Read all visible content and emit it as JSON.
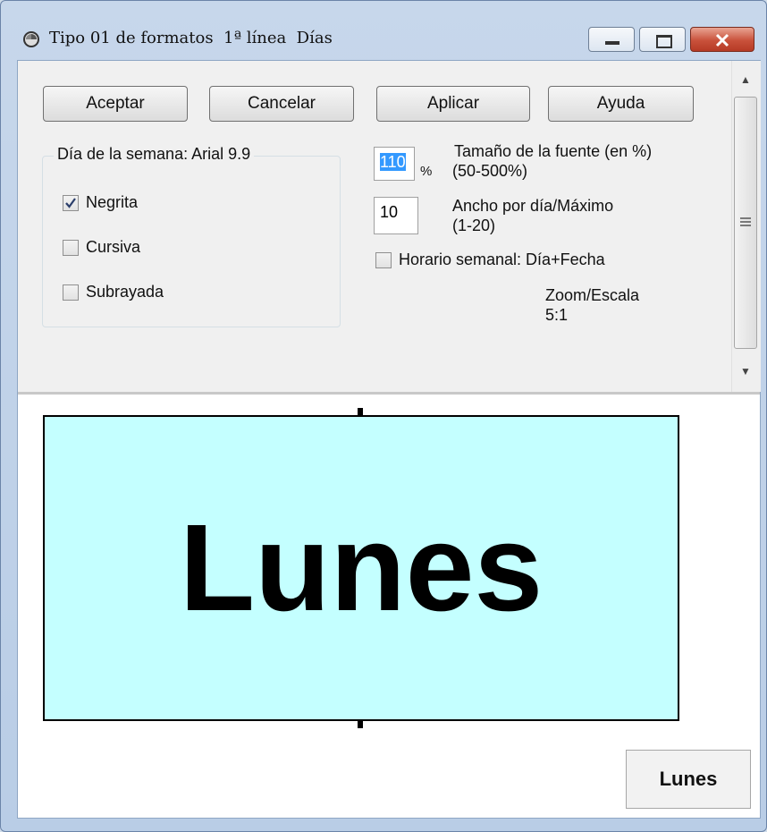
{
  "window": {
    "title": "Tipo 01 de formatos  1ª línea  Días"
  },
  "buttons": {
    "accept": "Aceptar",
    "cancel": "Cancelar",
    "apply": "Aplicar",
    "help": "Ayuda"
  },
  "font_group": {
    "legend": "Día de la semana: Arial 9.9",
    "bold": {
      "label": "Negrita",
      "checked": true
    },
    "italic": {
      "label": "Cursiva",
      "checked": false
    },
    "underline": {
      "label": "Subrayada",
      "checked": false
    }
  },
  "font_size": {
    "value": "110",
    "unit": "%",
    "label_line1": "Tamaño de la fuente (en %)",
    "label_line2": "(50-500%)"
  },
  "width_per_day": {
    "value": "10",
    "label_line1": "Ancho por día/Máximo",
    "label_line2": "(1-20)"
  },
  "weekly_schedule": {
    "label": "Horario semanal: Día+Fecha",
    "checked": false
  },
  "zoom": {
    "label": "Zoom/Escala",
    "value": "5:1"
  },
  "preview": {
    "text": "Lunes",
    "small_text": "Lunes",
    "background": "#c4ffff"
  },
  "colors": {
    "selection": "#3399ff",
    "panel": "#f0f0f0",
    "close_button": "#c9513b"
  }
}
